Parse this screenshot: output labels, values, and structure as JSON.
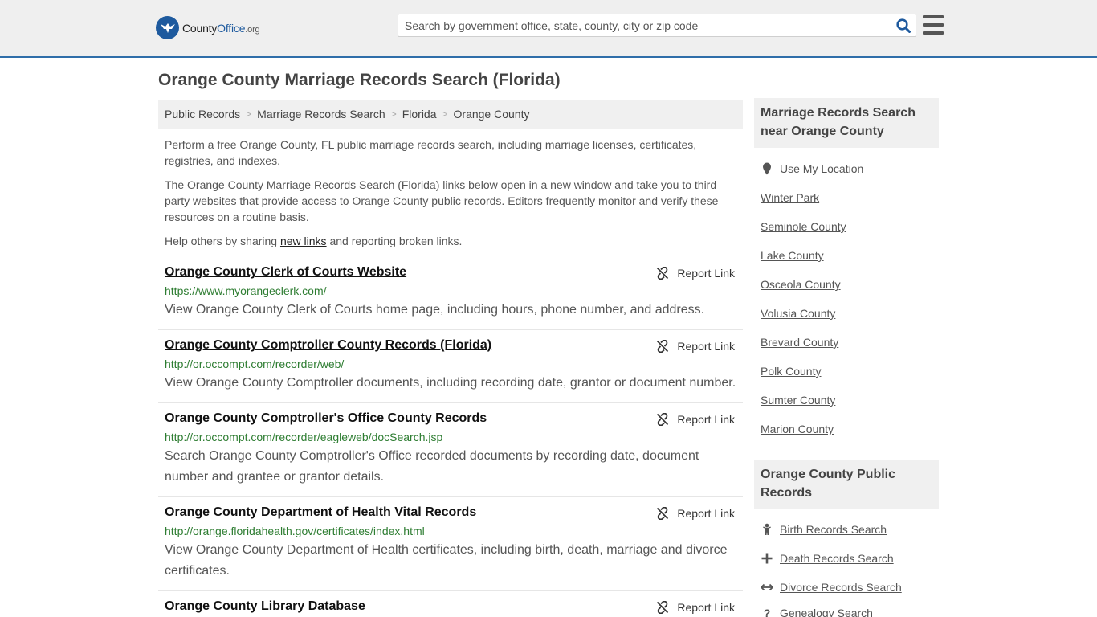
{
  "header": {
    "logo_main": "County",
    "logo_accent": "Office",
    "logo_tld": ".org",
    "search_placeholder": "Search by government office, state, county, city or zip code"
  },
  "page_title": "Orange County Marriage Records Search (Florida)",
  "breadcrumb": [
    "Public Records",
    "Marriage Records Search",
    "Florida",
    "Orange County"
  ],
  "intro": {
    "p1": "Perform a free Orange County, FL public marriage records search, including marriage licenses, certificates, registries, and indexes.",
    "p2": "The Orange County Marriage Records Search (Florida) links below open in a new window and take you to third party websites that provide access to Orange County public records. Editors frequently monitor and verify these resources on a routine basis.",
    "p3_before": "Help others by sharing ",
    "p3_link": "new links",
    "p3_after": " and reporting broken links."
  },
  "report_label": "Report Link",
  "results": [
    {
      "title": "Orange County Clerk of Courts Website",
      "url": "https://www.myorangeclerk.com/",
      "desc": "View Orange County Clerk of Courts home page, including hours, phone number, and address."
    },
    {
      "title": "Orange County Comptroller County Records (Florida)",
      "url": "http://or.occompt.com/recorder/web/",
      "desc": "View Orange County Comptroller documents, including recording date, grantor or document number."
    },
    {
      "title": "Orange County Comptroller's Office County Records",
      "url": "http://or.occompt.com/recorder/eagleweb/docSearch.jsp",
      "desc": "Search Orange County Comptroller's Office recorded documents by recording date, document number and grantee or grantor details."
    },
    {
      "title": "Orange County Department of Health Vital Records",
      "url": "http://orange.floridahealth.gov/certificates/index.html",
      "desc": "View Orange County Department of Health certificates, including birth, death, marriage and divorce certificates."
    },
    {
      "title": "Orange County Library Database",
      "url": "",
      "desc": ""
    }
  ],
  "sidebar": {
    "nearby_heading": "Marriage Records Search near Orange County",
    "use_location": "Use My Location",
    "nearby": [
      "Winter Park",
      "Seminole County",
      "Lake County",
      "Osceola County",
      "Volusia County",
      "Brevard County",
      "Polk County",
      "Sumter County",
      "Marion County"
    ],
    "public_heading": "Orange County Public Records",
    "public_records": [
      {
        "label": "Birth Records Search",
        "icon": "baby-icon"
      },
      {
        "label": "Death Records Search",
        "icon": "cross-icon"
      },
      {
        "label": "Divorce Records Search",
        "icon": "split-arrows-icon"
      },
      {
        "label": "Genealogy Search",
        "icon": "question-icon"
      }
    ]
  },
  "colors": {
    "brand": "#1e5a9e",
    "url_green": "#2e7d32",
    "header_bg": "#efefef"
  }
}
